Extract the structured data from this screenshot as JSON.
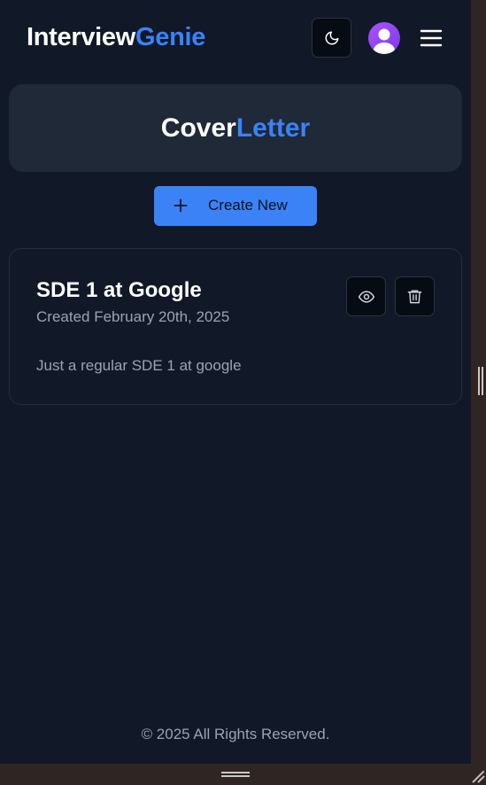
{
  "header": {
    "logo_primary": "Interview",
    "logo_accent": "Genie",
    "theme_toggle_icon": "moon-icon",
    "avatar_icon": "user-avatar-icon",
    "menu_icon": "hamburger-menu-icon"
  },
  "page": {
    "title_primary": "Cover",
    "title_accent": "Letter"
  },
  "actions": {
    "create_label": "Create New",
    "create_icon": "plus-icon"
  },
  "letters": [
    {
      "title": "SDE 1 at Google",
      "created": "Created February 20th, 2025",
      "description": "Just a regular SDE 1 at google",
      "view_icon": "eye-icon",
      "delete_icon": "trash-icon"
    }
  ],
  "footer": {
    "text": "© 2025 All Rights Reserved."
  },
  "colors": {
    "background": "#111827",
    "card": "#1f2937",
    "accent": "#3b82f6",
    "muted_text": "#9ca3af",
    "avatar": "#a855f7"
  }
}
